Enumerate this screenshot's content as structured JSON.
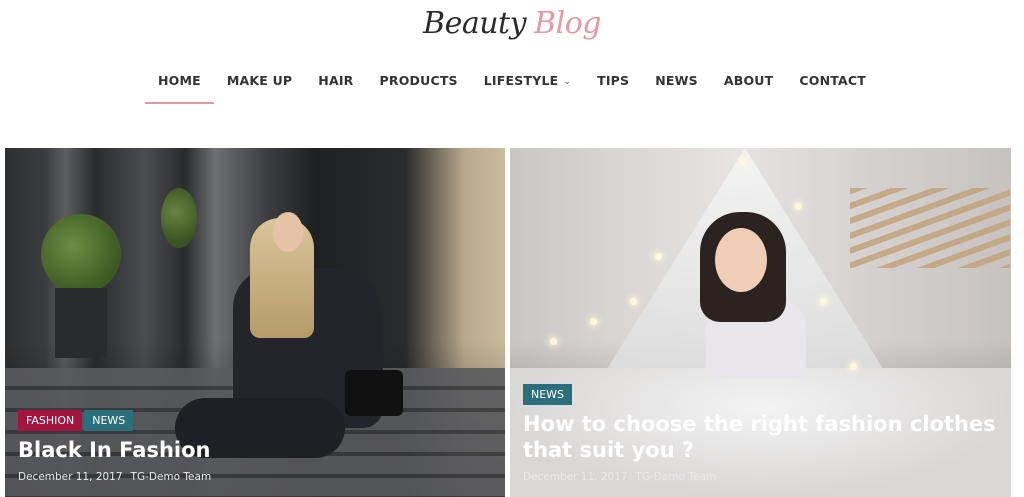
{
  "logo": {
    "part1": "Beauty",
    "part2": "Blog"
  },
  "nav": {
    "items": [
      {
        "label": "HOME"
      },
      {
        "label": "MAKE UP"
      },
      {
        "label": "HAIR"
      },
      {
        "label": "PRODUCTS"
      },
      {
        "label": "LIFESTYLE"
      },
      {
        "label": "TIPS"
      },
      {
        "label": "NEWS"
      },
      {
        "label": "ABOUT"
      },
      {
        "label": "CONTACT"
      }
    ],
    "active": "HOME",
    "dropdown_icon": "chevron-down-icon"
  },
  "posts": [
    {
      "tags": [
        "FASHION",
        "NEWS"
      ],
      "title": "Black In Fashion",
      "date": "December 11, 2017",
      "author": "TG-Demo Team"
    },
    {
      "tags": [
        "NEWS"
      ],
      "title": "How to choose the right fashion clothes that suit you ?",
      "date": "December 11, 2017",
      "author": "TG-Demo Team"
    }
  ],
  "colors": {
    "accent": "#e3999e",
    "tag_fashion": "#a3143f",
    "tag_news": "#2c6f7c",
    "nav_text": "#333333"
  }
}
